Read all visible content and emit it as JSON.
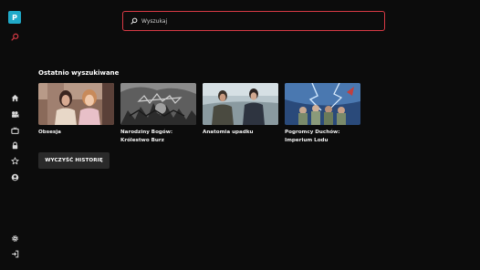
{
  "sidebar": {
    "profile_initial": "P",
    "items": [
      {
        "name": "search",
        "icon": "search-icon"
      },
      {
        "name": "home",
        "icon": "home-icon"
      },
      {
        "name": "movies",
        "icon": "film-camera-icon"
      },
      {
        "name": "series",
        "icon": "tv-icon"
      },
      {
        "name": "kids",
        "icon": "lock-icon"
      },
      {
        "name": "favorites",
        "icon": "star-icon"
      },
      {
        "name": "profile",
        "icon": "user-icon"
      },
      {
        "name": "settings",
        "icon": "gear-icon"
      },
      {
        "name": "logout",
        "icon": "logout-icon"
      }
    ]
  },
  "search": {
    "placeholder": "Wyszukaj",
    "value": ""
  },
  "recent": {
    "title": "Ostatnio wyszukiwane",
    "items": [
      {
        "title": "Obsesja"
      },
      {
        "title": "Narodziny Bogów: Królestwo Burz"
      },
      {
        "title": "Anatomia upadku"
      },
      {
        "title": "Pogromcy Duchów: Imperium Lodu"
      }
    ],
    "clear_label": "WYCZYŚĆ HISTORIĘ"
  },
  "colors": {
    "background": "#0c0c0c",
    "accent": "#d83a45",
    "profile_badge": "#20a9c8",
    "button": "#2a2a2a"
  }
}
